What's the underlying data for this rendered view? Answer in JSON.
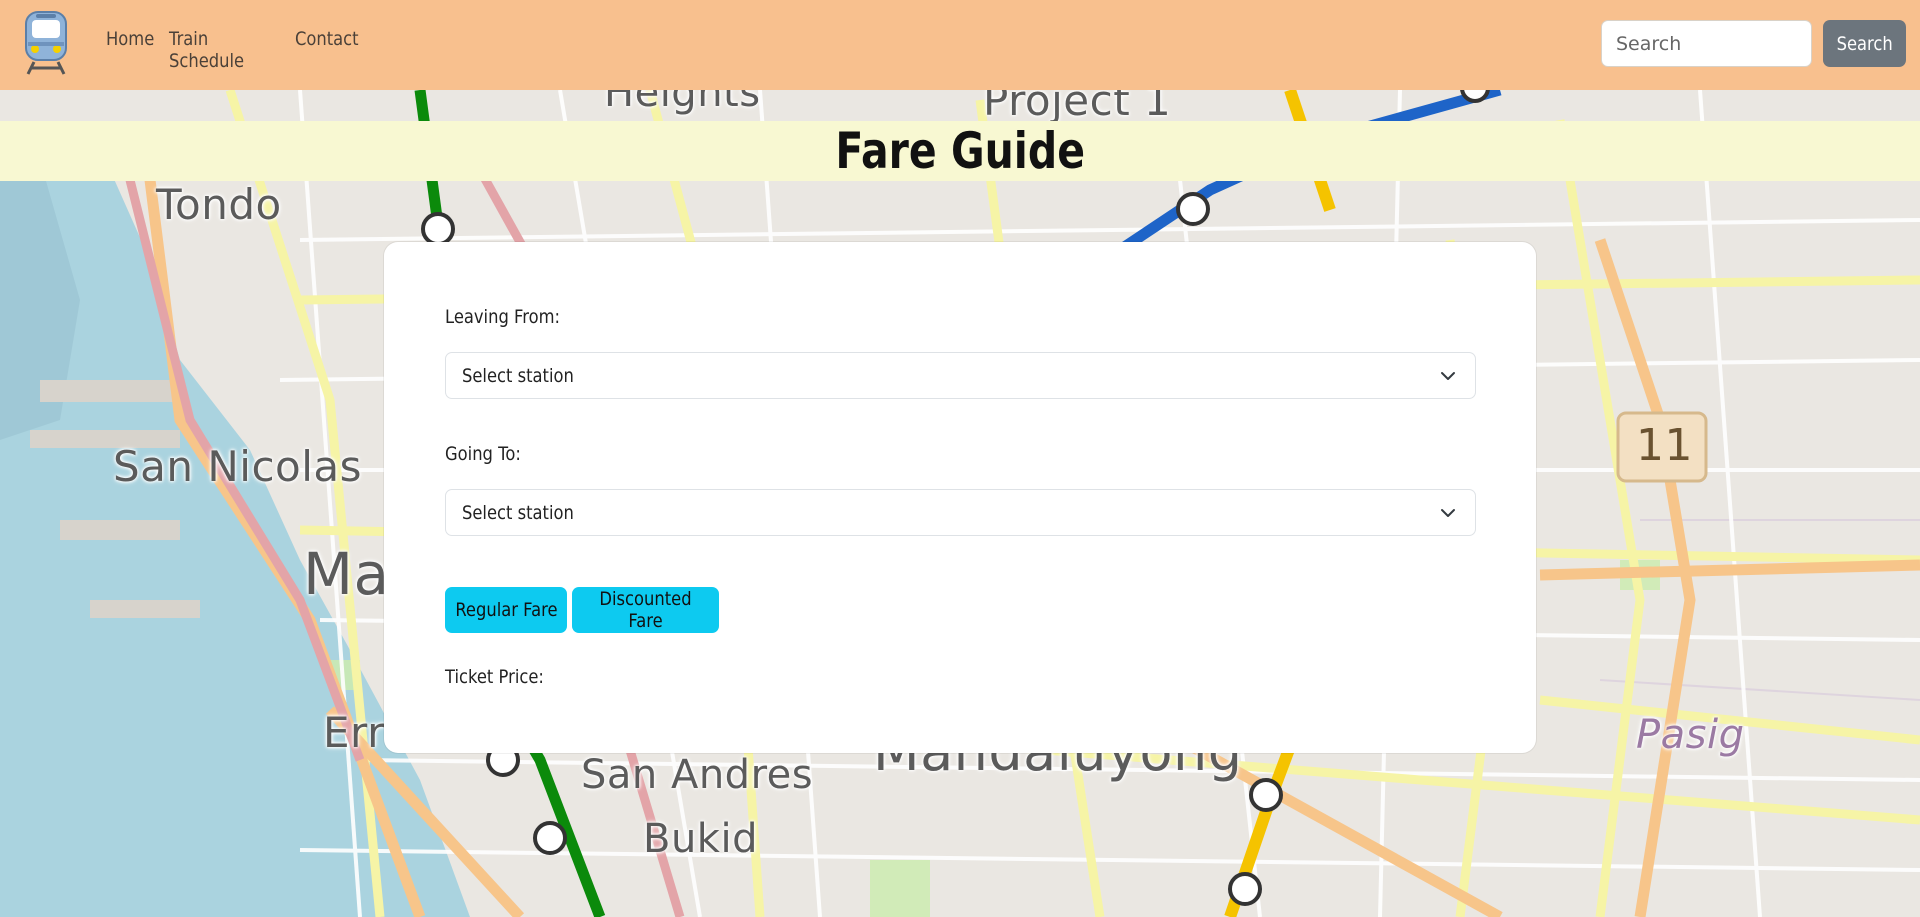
{
  "navbar": {
    "logo_icon": "train-icon",
    "links": [
      "Home",
      "Train Schedule",
      "Contact"
    ],
    "search_placeholder": "Search",
    "search_button": "Search",
    "background_color": "#f8c08e"
  },
  "title_band": {
    "title": "Fare Guide",
    "background_color": "#f8f8d2"
  },
  "fare_form": {
    "leaving_label": "Leaving From:",
    "leaving_value": "Select station",
    "going_label": "Going To:",
    "going_value": "Select station",
    "regular_button": "Regular Fare",
    "discounted_button": "Discounted Fare",
    "price_label": "Ticket Price:",
    "button_color": "#0dcaf0"
  },
  "map": {
    "labels": [
      "Heights",
      "Project 1",
      "Tondo",
      "San Nicolas",
      "Ma",
      "Err",
      "San Andres",
      "Bukid",
      "Mandaluyong",
      "Pasig",
      "11"
    ]
  }
}
